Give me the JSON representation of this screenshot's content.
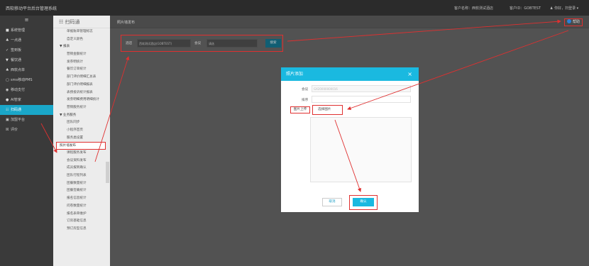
{
  "app": {
    "title": "西软移动平台后台管理系统"
  },
  "header": {
    "customer_name": "客户名称：西软测试酒店",
    "customer_id": "客户ID：GOBTEST",
    "user": "♟ 你好，扫登录 ▾"
  },
  "sidebar": {
    "collapse_icon": "≡",
    "items": [
      {
        "icon": "■",
        "label": "系统管理"
      },
      {
        "icon": "♣",
        "label": "一点通"
      },
      {
        "icon": "✓",
        "label": "签到板"
      },
      {
        "icon": "▼",
        "label": "餐饮通"
      },
      {
        "icon": "♣",
        "label": "西软点单"
      },
      {
        "icon": "▢",
        "label": "sms移动PMS"
      },
      {
        "icon": "◉",
        "label": "移动支付"
      },
      {
        "icon": "●",
        "label": "AI管家"
      },
      {
        "icon": "☷",
        "label": "扫码通"
      },
      {
        "icon": "▣",
        "label": "加盟平台"
      },
      {
        "icon": "☒",
        "label": "评价"
      }
    ]
  },
  "submenu": {
    "title": "扫码通",
    "items": [
      {
        "type": "item",
        "label": "单据账单管理标志"
      },
      {
        "type": "item",
        "label": "自定义颜色"
      },
      {
        "type": "group",
        "label": "▼ 报表"
      },
      {
        "type": "item",
        "label": "营销金额统计"
      },
      {
        "type": "item",
        "label": "发券明统计"
      },
      {
        "type": "item",
        "label": "餐饮订单统计"
      },
      {
        "type": "item",
        "label": "部门评价明细汇总表"
      },
      {
        "type": "item",
        "label": "部门评价明细报表"
      },
      {
        "type": "item",
        "label": "表扬投诉统计报表"
      },
      {
        "type": "item",
        "label": "发券明细费用明细统计"
      },
      {
        "type": "item",
        "label": "营销服务统计"
      },
      {
        "type": "group",
        "label": "▼ 业务服务"
      },
      {
        "type": "item",
        "label": "团队同步"
      },
      {
        "type": "item",
        "label": "小程序首页"
      },
      {
        "type": "item",
        "label": "服务类设置"
      },
      {
        "type": "item",
        "label": "照片墙发布",
        "active": true
      },
      {
        "type": "item",
        "label": "课程服务发布"
      },
      {
        "type": "item",
        "label": "会议资料发布"
      },
      {
        "type": "item",
        "label": "成员报到确认"
      },
      {
        "type": "item",
        "label": "团队行程列表"
      },
      {
        "type": "item",
        "label": "团餐数量统计"
      },
      {
        "type": "item",
        "label": "团餐签确统计"
      },
      {
        "type": "item",
        "label": "报名信息统计"
      },
      {
        "type": "item",
        "label": "问卷数量统计"
      },
      {
        "type": "item",
        "label": "报名表单维护"
      },
      {
        "type": "item",
        "label": "订房基础信息"
      },
      {
        "type": "item",
        "label": "预订房型信息"
      }
    ]
  },
  "main": {
    "breadcrumb": "照片墙发布",
    "help_label": "帮助",
    "filter": {
      "label1": "酒店",
      "select1": "西软测试酒店(GOBTEST)",
      "label2": "会议",
      "select2": "请选",
      "search_label": "搜索"
    }
  },
  "modal": {
    "title": "照片添加",
    "close": "×",
    "meeting_label": "会议",
    "meeting_value": "GX20000000016",
    "sort_label": "排序",
    "sort_value": "",
    "upload_label": "图片上传",
    "pick_button": "选择图片",
    "cancel_label": "取消",
    "confirm_label": "确认"
  },
  "colors": {
    "accent": "#1ab9e0",
    "annotation": "#e03030"
  }
}
